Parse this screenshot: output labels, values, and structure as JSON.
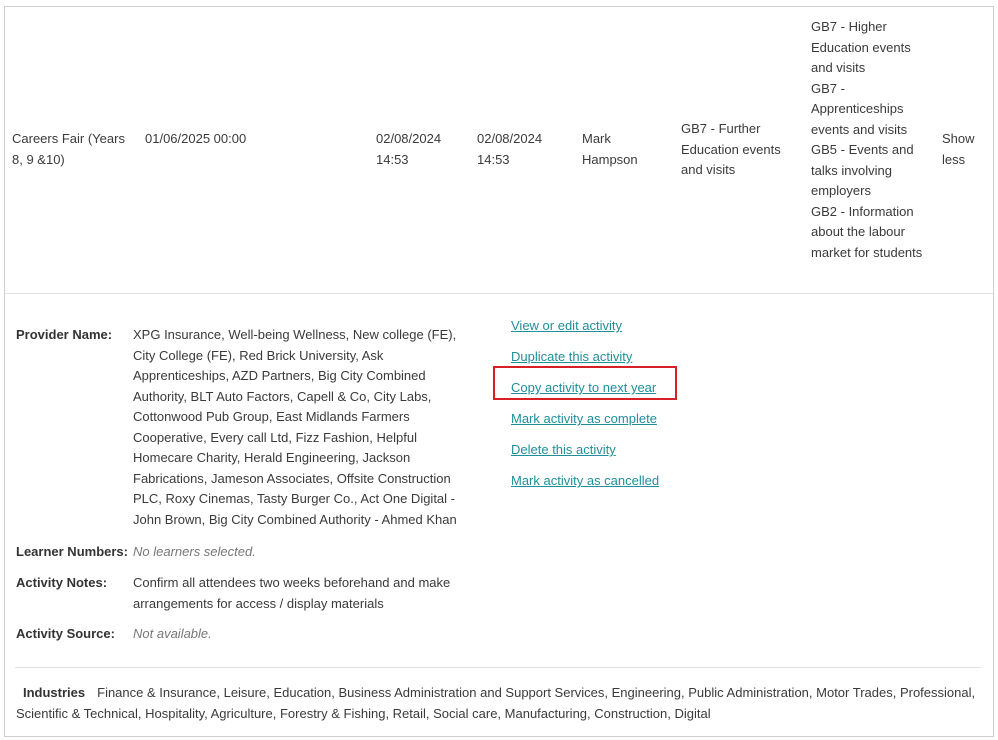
{
  "activity": {
    "name": "Careers Fair (Years 8, 9 &10)",
    "date": "01/06/2025 00:00",
    "created": "02/08/2024 14:53",
    "modified": "02/08/2024 14:53",
    "person": "Mark Hampson",
    "benchmark_col1": "GB7 - Further Education events and visits",
    "benchmark_col2": [
      "GB7 - Higher Education events and visits",
      "GB7 - Apprenticeships events and visits",
      "GB5 - Events and talks involving employers",
      "GB2 - Information about the labour market for students"
    ],
    "toggle_label": "Show less"
  },
  "details": {
    "provider_label": "Provider Name:",
    "provider_value": "XPG Insurance, Well-being Wellness, New college (FE), City College (FE), Red Brick University, Ask Apprenticeships, AZD Partners, Big City Combined Authority, BLT Auto Factors, Capell & Co, City Labs, Cottonwood Pub Group, East Midlands Farmers Cooperative, Every call Ltd, Fizz Fashion, Helpful Homecare Charity, Herald Engineering, Jackson Fabrications, Jameson Associates, Offsite Construction PLC, Roxy Cinemas, Tasty Burger Co., Act One Digital - John Brown, Big City Combined Authority - Ahmed Khan",
    "learners_label": "Learner Numbers:",
    "learners_value": "No learners selected.",
    "notes_label": "Activity Notes:",
    "notes_value": "Confirm all attendees two weeks beforehand and make arrangements for access / display materials",
    "source_label": "Activity Source:",
    "source_value": "Not available."
  },
  "actions": {
    "view_edit": "View or edit activity",
    "duplicate": "Duplicate this activity",
    "copy_next_year": "Copy activity to next year",
    "mark_complete": "Mark activity as complete",
    "delete": "Delete this activity",
    "mark_cancelled": "Mark activity as cancelled"
  },
  "industries": {
    "label": "Industries",
    "value": "Finance & Insurance, Leisure, Education, Business Administration and Support Services, Engineering, Public Administration, Motor Trades, Professional, Scientific & Technical, Hospitality, Agriculture, Forestry & Fishing, Retail, Social care, Manufacturing, Construction, Digital"
  },
  "colors": {
    "link": "#1f8f9a",
    "highlight": "#d62026"
  }
}
